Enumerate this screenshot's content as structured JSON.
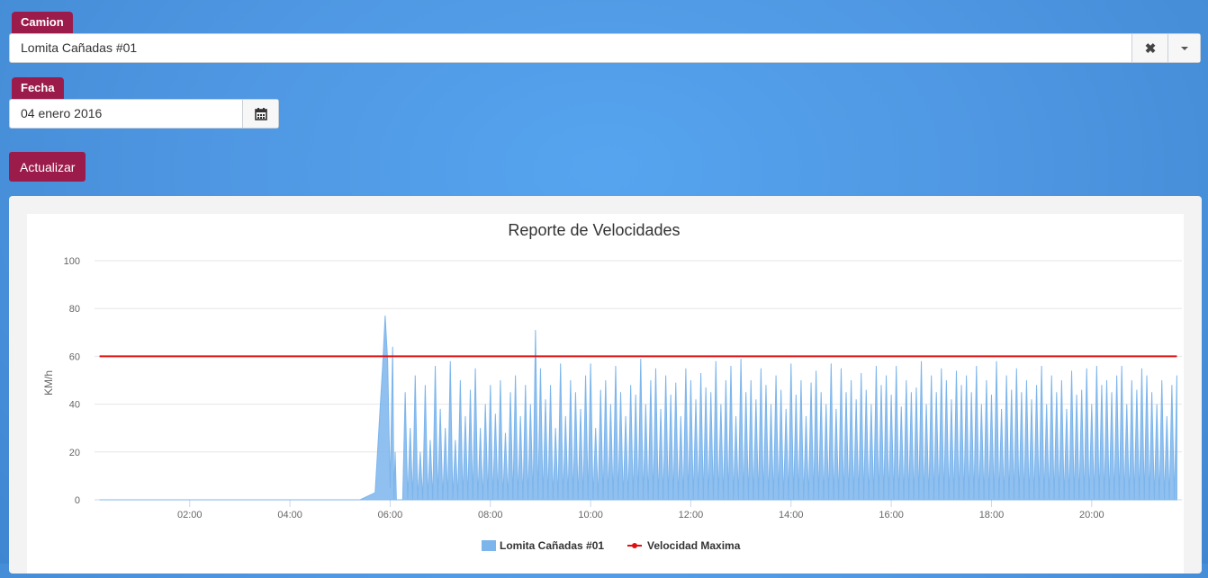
{
  "form": {
    "truck_label": "Camion",
    "truck_value": "Lomita Cañadas #01",
    "date_label": "Fecha",
    "date_value": "04 enero 2016",
    "update_label": "Actualizar"
  },
  "icons": {
    "clear": "close-icon",
    "dropdown": "chevron-down-icon",
    "calendar": "calendar-icon"
  },
  "colors": {
    "accent": "#9b1c4b",
    "series_speed": "#7cb5ec",
    "series_max": "#e01010"
  },
  "chart_data": {
    "type": "line",
    "title": "Reporte de Velocidades",
    "ylabel": "KM/h",
    "ylim": [
      0,
      100
    ],
    "yticks": [
      0,
      20,
      40,
      60,
      80,
      100
    ],
    "xlim_hours": [
      0.1,
      21.8
    ],
    "xticks": [
      "02:00",
      "04:00",
      "06:00",
      "08:00",
      "10:00",
      "12:00",
      "14:00",
      "16:00",
      "18:00",
      "20:00"
    ],
    "xtick_hours": [
      2,
      4,
      6,
      8,
      10,
      12,
      14,
      16,
      18,
      20
    ],
    "legend_position": "bottom-center",
    "series": [
      {
        "name": "Lomita Cañadas #01",
        "type": "area",
        "x_hours": [
          0.2,
          5.4,
          5.5,
          5.7,
          5.85,
          5.9,
          5.95,
          6.0,
          6.05,
          6.1,
          6.15,
          6.2,
          6.3,
          6.4,
          6.5,
          6.6,
          6.7,
          6.8,
          6.9,
          7.0,
          7.1,
          7.2,
          7.3,
          7.4,
          7.5,
          7.6,
          7.7,
          7.8,
          7.9,
          8.0,
          8.1,
          8.2,
          8.3,
          8.4,
          8.5,
          8.6,
          8.7,
          8.8,
          8.9,
          9.0,
          9.1,
          9.2,
          9.3,
          9.4,
          9.5,
          9.6,
          9.7,
          9.8,
          9.9,
          10.0,
          10.1,
          10.2,
          10.3,
          10.4,
          10.5,
          10.6,
          10.7,
          10.8,
          10.9,
          11.0,
          11.1,
          11.2,
          11.3,
          11.4,
          11.5,
          11.6,
          11.7,
          11.8,
          11.9,
          12.0,
          12.1,
          12.2,
          12.3,
          12.4,
          12.5,
          12.6,
          12.7,
          12.8,
          12.9,
          13.0,
          13.1,
          13.2,
          13.3,
          13.4,
          13.5,
          13.6,
          13.7,
          13.8,
          13.9,
          14.0,
          14.1,
          14.2,
          14.3,
          14.4,
          14.5,
          14.6,
          14.7,
          14.8,
          14.9,
          15.0,
          15.1,
          15.2,
          15.3,
          15.4,
          15.5,
          15.6,
          15.7,
          15.8,
          15.9,
          16.0,
          16.1,
          16.2,
          16.3,
          16.4,
          16.5,
          16.6,
          16.7,
          16.8,
          16.9,
          17.0,
          17.1,
          17.2,
          17.3,
          17.4,
          17.5,
          17.6,
          17.7,
          17.8,
          17.9,
          18.0,
          18.1,
          18.2,
          18.3,
          18.4,
          18.5,
          18.6,
          18.7,
          18.8,
          18.9,
          19.0,
          19.1,
          19.2,
          19.3,
          19.4,
          19.5,
          19.6,
          19.7,
          19.8,
          19.9,
          20.0,
          20.1,
          20.2,
          20.3,
          20.4,
          20.5,
          20.6,
          20.7,
          20.8,
          20.9,
          21.0,
          21.1,
          21.2,
          21.3,
          21.4,
          21.5,
          21.6,
          21.7
        ],
        "values": [
          0,
          0,
          1,
          3,
          56,
          77,
          58,
          5,
          64,
          20,
          0,
          0,
          45,
          30,
          52,
          20,
          48,
          25,
          56,
          38,
          30,
          58,
          25,
          50,
          35,
          46,
          55,
          30,
          40,
          48,
          36,
          50,
          28,
          45,
          52,
          35,
          48,
          40,
          71,
          55,
          42,
          48,
          30,
          57,
          35,
          50,
          45,
          38,
          52,
          57,
          30,
          46,
          50,
          40,
          56,
          45,
          35,
          48,
          44,
          59,
          40,
          50,
          55,
          38,
          52,
          44,
          49,
          35,
          55,
          50,
          42,
          53,
          47,
          45,
          58,
          40,
          50,
          56,
          35,
          59,
          45,
          50,
          42,
          55,
          48,
          40,
          52,
          46,
          38,
          57,
          44,
          50,
          35,
          49,
          54,
          45,
          40,
          57,
          38,
          55,
          45,
          50,
          42,
          53,
          46,
          40,
          56,
          48,
          52,
          44,
          56,
          39,
          50,
          45,
          47,
          58,
          40,
          52,
          45,
          55,
          50,
          42,
          54,
          48,
          52,
          45,
          56,
          40,
          50,
          44,
          58,
          38,
          52,
          46,
          55,
          45,
          50,
          42,
          48,
          56,
          40,
          52,
          45,
          50,
          38,
          54,
          44,
          46,
          55,
          40,
          56,
          48,
          50,
          45,
          52,
          56,
          40,
          50,
          46,
          55,
          52,
          45,
          40,
          50,
          35,
          48,
          52,
          12
        ]
      },
      {
        "name": "Velocidad Maxima",
        "type": "line",
        "x_hours": [
          0.2,
          21.7
        ],
        "values": [
          60,
          60
        ]
      }
    ]
  }
}
